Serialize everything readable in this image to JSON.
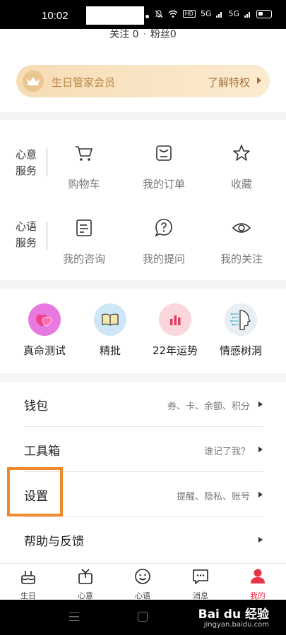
{
  "status_bar": {
    "time": "10:02",
    "indicators": [
      "HD",
      "5G",
      "5G"
    ]
  },
  "profile": {
    "follow": "关注 0",
    "fans": "粉丝0",
    "separator": "·"
  },
  "vip_banner": {
    "title": "生日管家会员",
    "action": "了解特权"
  },
  "services": {
    "row1": {
      "label_line1": "心意",
      "label_line2": "服务",
      "items": [
        {
          "label": "购物车",
          "icon": "cart-icon"
        },
        {
          "label": "我的订单",
          "icon": "receipt-icon"
        },
        {
          "label": "收藏",
          "icon": "star-icon"
        }
      ]
    },
    "row2": {
      "label_line1": "心语",
      "label_line2": "服务",
      "items": [
        {
          "label": "我的咨询",
          "icon": "document-icon"
        },
        {
          "label": "我的提问",
          "icon": "question-icon"
        },
        {
          "label": "我的关注",
          "icon": "eye-icon"
        }
      ]
    }
  },
  "features": [
    {
      "label": "真命测试",
      "icon": "hearts-icon",
      "color": "#e879e0"
    },
    {
      "label": "精批",
      "icon": "book-icon",
      "color": "#cfe6f7"
    },
    {
      "label": "22年运势",
      "icon": "chart-icon",
      "color": "#f9d7dc"
    },
    {
      "label": "情感树洞",
      "icon": "ai-head-icon",
      "color": "#e9eef2"
    }
  ],
  "menu": [
    {
      "name": "钱包",
      "hint": "券、卡、余额、积分"
    },
    {
      "name": "工具箱",
      "hint": "谁记了我？"
    },
    {
      "name": "设置",
      "hint": "提醒、隐私、账号"
    },
    {
      "name": "帮助与反馈",
      "hint": ""
    }
  ],
  "tabs": [
    {
      "label": "生日",
      "icon": "cake-icon"
    },
    {
      "label": "心意",
      "icon": "gift-icon"
    },
    {
      "label": "心语",
      "icon": "smile-icon"
    },
    {
      "label": "消息",
      "icon": "message-icon"
    },
    {
      "label": "我的",
      "icon": "person-icon"
    }
  ],
  "accent_color": "#e8334a",
  "highlight_color": "#f08a2c",
  "watermark": {
    "brand": "Bai du 经验",
    "url": "jingyan.baidu.com"
  }
}
